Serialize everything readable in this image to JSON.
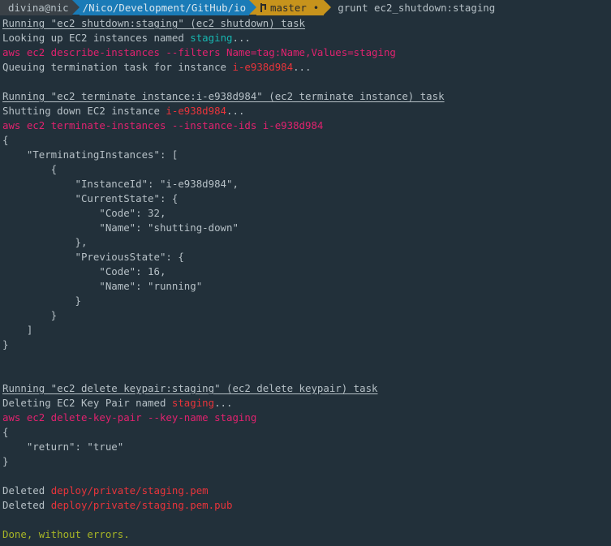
{
  "prompt": {
    "user_host": "divina@nic",
    "path": "/Nico/Development/GitHub/io",
    "branch_icon": "git-branch-icon",
    "branch": "master",
    "dirty_marker": "•",
    "command": "grunt ec2_shutdown:staging"
  },
  "colors": {
    "background": "#22303a",
    "text": "#b6c0c6",
    "cyan": "#17b6b0",
    "magenta": "#e0226e",
    "red": "#e8343a",
    "success": "#a7b526",
    "segment_user": "#3a4147",
    "segment_path": "#1a7bb7",
    "segment_branch": "#c7931c"
  },
  "lines": [
    [
      {
        "t": "Running \"ec2_shutdown:staging\" (ec2_shutdown) task",
        "c": "default",
        "u": true
      }
    ],
    [
      {
        "t": "Looking up EC2 instances named ",
        "c": "default"
      },
      {
        "t": "staging",
        "c": "cyan"
      },
      {
        "t": "...",
        "c": "default"
      }
    ],
    [
      {
        "t": "aws ec2 describe-instances --filters Name=tag:Name,Values=staging",
        "c": "magenta"
      }
    ],
    [
      {
        "t": "Queuing termination task for instance ",
        "c": "default"
      },
      {
        "t": "i-e938d984",
        "c": "red"
      },
      {
        "t": "...",
        "c": "default"
      }
    ],
    [],
    [
      {
        "t": "Running \"ec2_terminate_instance:i-e938d984\" (ec2_terminate_instance) task",
        "c": "default",
        "u": true
      }
    ],
    [
      {
        "t": "Shutting down EC2 instance ",
        "c": "default"
      },
      {
        "t": "i-e938d984",
        "c": "red"
      },
      {
        "t": "...",
        "c": "default"
      }
    ],
    [
      {
        "t": "aws ec2 terminate-instances --instance-ids i-e938d984",
        "c": "magenta"
      }
    ],
    [
      {
        "t": "{",
        "c": "default"
      }
    ],
    [
      {
        "t": "    \"TerminatingInstances\": [",
        "c": "default"
      }
    ],
    [
      {
        "t": "        {",
        "c": "default"
      }
    ],
    [
      {
        "t": "            \"InstanceId\": \"i-e938d984\",",
        "c": "default"
      }
    ],
    [
      {
        "t": "            \"CurrentState\": {",
        "c": "default"
      }
    ],
    [
      {
        "t": "                \"Code\": 32,",
        "c": "default"
      }
    ],
    [
      {
        "t": "                \"Name\": \"shutting-down\"",
        "c": "default"
      }
    ],
    [
      {
        "t": "            },",
        "c": "default"
      }
    ],
    [
      {
        "t": "            \"PreviousState\": {",
        "c": "default"
      }
    ],
    [
      {
        "t": "                \"Code\": 16,",
        "c": "default"
      }
    ],
    [
      {
        "t": "                \"Name\": \"running\"",
        "c": "default"
      }
    ],
    [
      {
        "t": "            }",
        "c": "default"
      }
    ],
    [
      {
        "t": "        }",
        "c": "default"
      }
    ],
    [
      {
        "t": "    ]",
        "c": "default"
      }
    ],
    [
      {
        "t": "}",
        "c": "default"
      }
    ],
    [],
    [],
    [
      {
        "t": "Running \"ec2_delete_keypair:staging\" (ec2_delete_keypair) task",
        "c": "default",
        "u": true
      }
    ],
    [
      {
        "t": "Deleting EC2 Key Pair named ",
        "c": "default"
      },
      {
        "t": "staging",
        "c": "red"
      },
      {
        "t": "...",
        "c": "default"
      }
    ],
    [
      {
        "t": "aws ec2 delete-key-pair --key-name staging",
        "c": "magenta"
      }
    ],
    [
      {
        "t": "{",
        "c": "default"
      }
    ],
    [
      {
        "t": "    \"return\": \"true\"",
        "c": "default"
      }
    ],
    [
      {
        "t": "}",
        "c": "default"
      }
    ],
    [],
    [
      {
        "t": "Deleted ",
        "c": "default"
      },
      {
        "t": "deploy/private/staging.pem",
        "c": "red"
      }
    ],
    [
      {
        "t": "Deleted ",
        "c": "default"
      },
      {
        "t": "deploy/private/staging.pem.pub",
        "c": "red"
      }
    ],
    [],
    [
      {
        "t": "Done, without errors.",
        "c": "yellow"
      }
    ]
  ]
}
